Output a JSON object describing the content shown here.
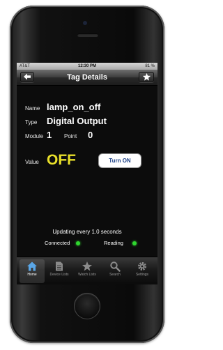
{
  "status_bar": {
    "carrier": "AT&T",
    "time": "12:30 PM",
    "battery": "81 %"
  },
  "nav": {
    "title": "Tag Details",
    "back_icon": "back-arrow-icon",
    "favorite_icon": "star-icon"
  },
  "tag": {
    "name_label": "Name",
    "name": "lamp_on_off",
    "type_label": "Type",
    "type": "Digital Output",
    "module_label": "Module",
    "module": "1",
    "point_label": "Point",
    "point": "0",
    "value_label": "Value",
    "value": "OFF",
    "action_label": "Turn ON"
  },
  "status": {
    "updating": "Updating every 1.0 seconds",
    "connected_label": "Connected",
    "reading_label": "Reading",
    "connected_color": "#2fd62f",
    "reading_color": "#2fd62f"
  },
  "tabs": [
    {
      "label": "Home",
      "icon": "home-icon",
      "active": true
    },
    {
      "label": "Device Lists",
      "icon": "device-list-icon",
      "active": false
    },
    {
      "label": "Watch Lists",
      "icon": "star-icon",
      "active": false
    },
    {
      "label": "Search",
      "icon": "search-icon",
      "active": false
    },
    {
      "label": "Settings",
      "icon": "gear-icon",
      "active": false
    }
  ],
  "colors": {
    "value_off": "#e9e02a",
    "button_text": "#1b3f86"
  }
}
